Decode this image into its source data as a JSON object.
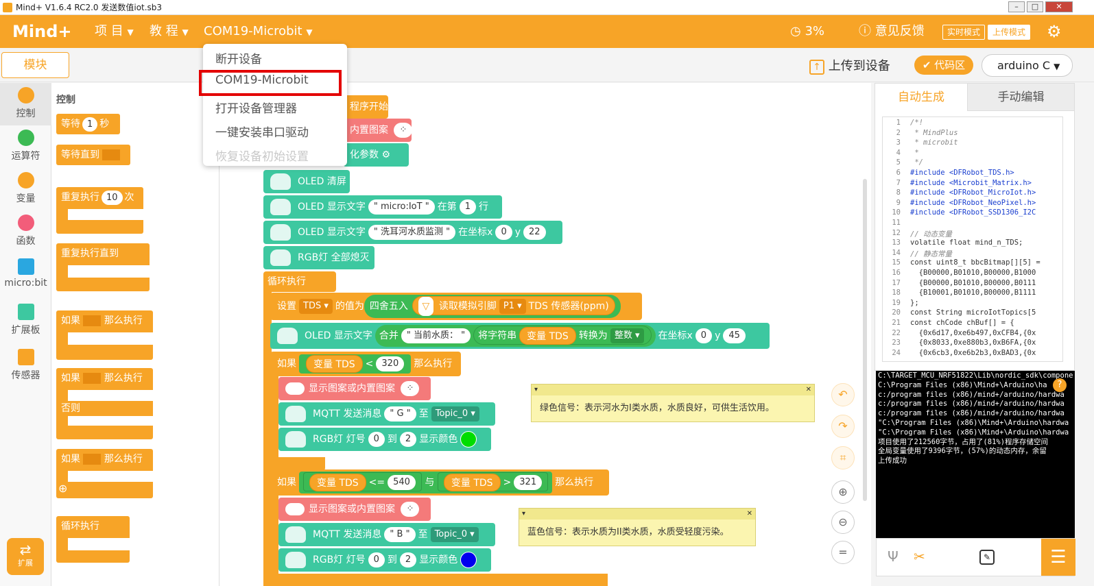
{
  "titlebar": {
    "title": "Mind+ V1.6.4 RC2.0  发送数值iot.sb3"
  },
  "menubar": {
    "logo": "Mind+",
    "project": "项 目",
    "tutorial": "教 程",
    "device": "COM19-Microbit",
    "progress": "3%",
    "feedback": "意见反馈",
    "mode_realtime": "实时模式",
    "mode_upload": "上传模式"
  },
  "dropdown": {
    "items": [
      "断开设备",
      "COM19-Microbit",
      "打开设备管理器",
      "一键安装串口驱动",
      "恢复设备初始设置"
    ]
  },
  "toolbar": {
    "modules": "模块",
    "upload": "上传到设备",
    "code_area": "代码区",
    "board": "arduino C"
  },
  "categories": [
    {
      "label": "控制",
      "color": "#f7a427"
    },
    {
      "label": "运算符",
      "color": "#3cba54"
    },
    {
      "label": "变量",
      "color": "#f7a427"
    },
    {
      "label": "函数",
      "color": "#f25d7a"
    },
    {
      "label": "micro:bit"
    },
    {
      "label": "扩展板"
    },
    {
      "label": "传感器"
    }
  ],
  "extend": "扩展",
  "palette": {
    "header": "控制",
    "wait": "等待",
    "wait_val": "1",
    "wait_unit": "秒",
    "wait_until": "等待直到",
    "repeat": "重复执行",
    "repeat_val": "10",
    "repeat_unit": "次",
    "repeat_until": "重复执行直到",
    "if1": "如果",
    "then1": "那么执行",
    "if2": "如果",
    "then2": "那么执行",
    "else": "否则",
    "if3": "如果",
    "then3": "那么执行",
    "forever": "循环执行"
  },
  "workspace": {
    "b_start": "程序开始",
    "b_pattern0": "内置图案",
    "b_init": "化参数",
    "b_oled_clear": "OLED 清屏",
    "b_oled_text": "OLED 显示文字",
    "b_oled_text_val": "\" micro:IoT \"",
    "b_oled_text_at": "在第",
    "b_oled_text_line": "1",
    "b_oled_text_row": "行",
    "b_oled_text2": "OLED 显示文字",
    "b_oled_text2_val": "\" 洗耳河水质监测 \"",
    "b_oled_text2_at": "在坐标x",
    "b_oled_text2_x": "0",
    "b_oled_text2_y_label": "y",
    "b_oled_text2_y": "22",
    "b_rgb_off": "RGB灯 全部熄灭",
    "b_loop": "循环执行",
    "b_set": "设置",
    "b_set_var": "TDS",
    "b_set_val": "的值为",
    "b_round": "四舍五入",
    "b_read": "读取模拟引脚",
    "b_pin": "P1",
    "b_sensor": "TDS 传感器(ppm)",
    "b_oled3": "OLED 显示文字",
    "b_join": "合并",
    "b_join_str": "\" 当前水质： \"",
    "b_tostr": "将字符串",
    "b_var_tds": "变量 TDS",
    "b_convert": "转换为",
    "b_int": "整数",
    "b_oled3_at": "在坐标x",
    "b_oled3_x": "0",
    "b_oled3_y_label": "y",
    "b_oled3_y": "45",
    "b_if1": "如果",
    "b_if1_var": "变量 TDS",
    "b_if1_op": "<",
    "b_if1_val": "320",
    "b_if1_then": "那么执行",
    "b_show1": "显示图案或内置图案",
    "b_mqtt1": "MQTT 发送消息",
    "b_mqtt1_msg": "\" G \"",
    "b_mqtt1_to": "至",
    "b_mqtt1_topic": "Topic_0",
    "b_rgb1": "RGB灯 灯号",
    "b_rgb1_a": "0",
    "b_rgb1_to": "到",
    "b_rgb1_b": "2",
    "b_rgb1_color": "显示颜色",
    "b_if2": "如果",
    "b_if2_var1": "变量 TDS",
    "b_if2_op1": "<=",
    "b_if2_val1": "540",
    "b_if2_and": "与",
    "b_if2_var2": "变量 TDS",
    "b_if2_op2": ">",
    "b_if2_val2": "321",
    "b_if2_then": "那么执行",
    "b_show2": "显示图案或内置图案",
    "b_mqtt2": "MQTT 发送消息",
    "b_mqtt2_msg": "\" B \"",
    "b_mqtt2_to": "至",
    "b_mqtt2_topic": "Topic_0",
    "b_rgb2": "RGB灯 灯号",
    "b_rgb2_a": "0",
    "b_rgb2_to": "到",
    "b_rgb2_b": "2",
    "b_rgb2_color": "显示颜色",
    "note1": "绿色信号：表示河水为I类水质，水质良好，可供生活饮用。",
    "note2": "蓝色信号：表示水质为II类水质，水质受轻度污染。",
    "color_green": "#00dd00",
    "color_blue": "#0000ee"
  },
  "code": {
    "tab_auto": "自动生成",
    "tab_manual": "手动编辑",
    "lines": [
      "/*!",
      " * MindPlus",
      " * microbit",
      " *",
      " */",
      "#include <DFRobot_TDS.h>",
      "#include <Microbit_Matrix.h>",
      "#include <DFRobot_MicroIot.h>",
      "#include <DFRobot_NeoPixel.h>",
      "#include <DFRobot_SSD1306_I2C",
      "",
      "// 动态变量",
      "volatile float mind_n_TDS;",
      "// 静态常量",
      "const uint8_t bbcBitmap[][5] =",
      "  {B00000,B01010,B00000,B1000",
      "  {B00000,B01010,B00000,B0111",
      "  {B10001,B01010,B00000,B1111",
      "};",
      "const String microIotTopics[5",
      "const chCode chBuf[] = {",
      "  {0x6d17,0xe6b497,0xCFB4,{0x",
      "  {0x8033,0xe880b3,0xB6FA,{0x",
      "  {0x6cb3,0xe6b2b3,0xBAD3,{0x"
    ]
  },
  "console": {
    "lines": [
      "C:\\TARGET_MCU_NRF51822\\Lib\\nordic_sdk\\compone",
      "C:\\Program Files (x86)\\Mind+\\Arduino\\ha",
      "c:/program files (x86)/mind+/arduino/hardwa",
      "c:/program files (x86)/mind+/arduino/hardwa",
      "c:/program files (x86)/mind+/arduino/hardwa",
      "\"C:\\Program Files (x86)\\Mind+\\Arduino\\hardwa",
      "\"C:\\Program Files (x86)\\Mind+\\Arduino\\hardwa",
      "项目使用了212560字节，占用了(81%)程序存储空间",
      "全局变量使用了9396字节，(57%)的动态内存，余留",
      "上传成功"
    ]
  }
}
